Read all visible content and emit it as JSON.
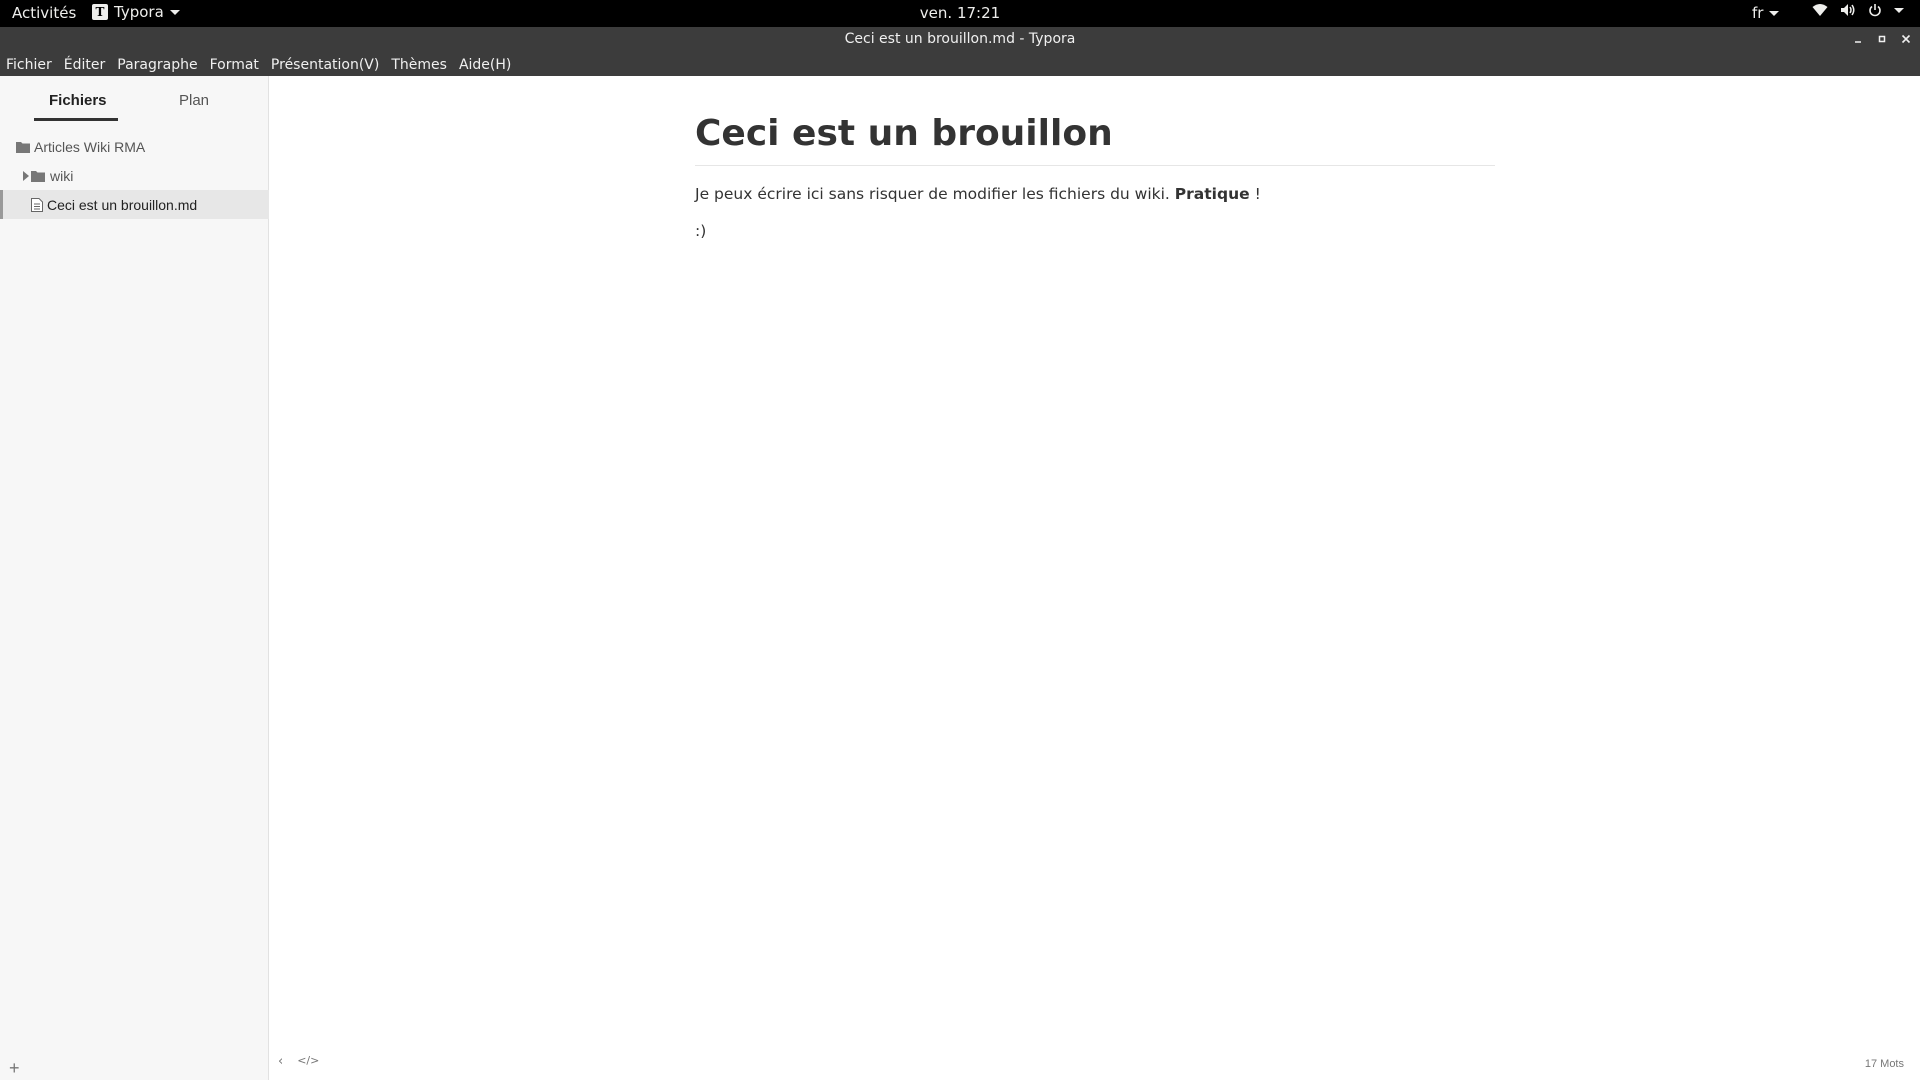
{
  "topbar": {
    "activities": "Activités",
    "app_name": "Typora",
    "app_logo_letter": "T",
    "clock": "ven. 17:21",
    "language": "fr",
    "icons": [
      "network-icon",
      "volume-icon",
      "power-icon"
    ]
  },
  "window": {
    "title": "Ceci est un brouillon.md - Typora"
  },
  "menu": {
    "items": [
      "Fichier",
      "Éditer",
      "Paragraphe",
      "Format",
      "Présentation(V)",
      "Thèmes",
      "Aide(H)"
    ]
  },
  "sidebar": {
    "tabs": [
      "Fichiers",
      "Plan"
    ],
    "active_tab": "Fichiers",
    "tree": {
      "root": "Articles Wiki RMA",
      "folder": "wiki",
      "file": "Ceci est un brouillon.md"
    },
    "add_label": "+"
  },
  "document": {
    "heading": "Ceci est un brouillon",
    "paragraph_text": "Je peux écrire ici sans risquer de modifier les fichiers du wiki. ",
    "paragraph_bold": "Pratique",
    "paragraph_end": " !",
    "smiley": ":)"
  },
  "status": {
    "toggle_sidebar_icon": "‹",
    "source_mode_icon": "</>",
    "word_count": "17 Mots"
  },
  "colors": {
    "topbar_bg": "#000000",
    "titlebar_bg": "#3c3c3c",
    "sidebar_bg": "#f7f7f7",
    "text": "#333333"
  }
}
